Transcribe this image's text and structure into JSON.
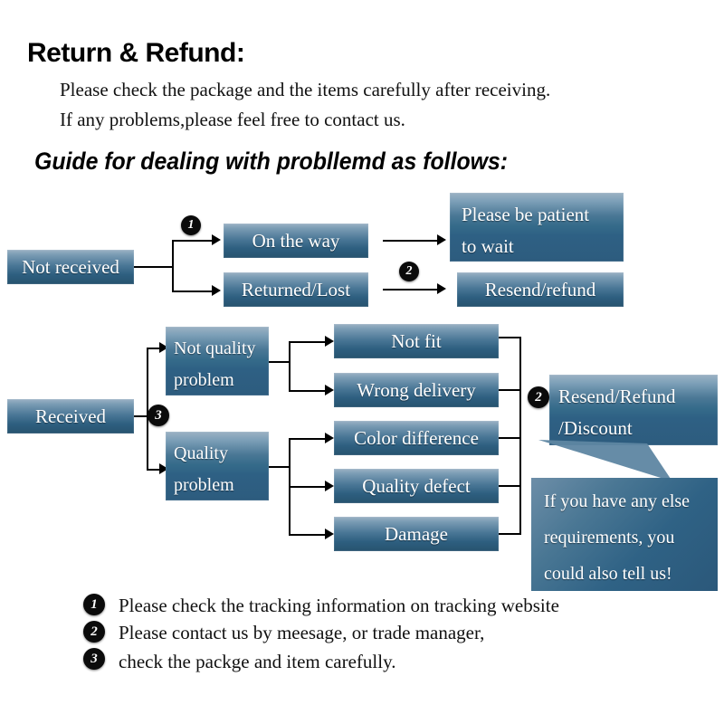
{
  "header": {
    "title": "Return & Refund:",
    "lead_line1": "Please check the package and the items carefully after receiving.",
    "lead_line2": "If any problems,please feel free to contact us.",
    "guide": "Guide for dealing with probllemd as follows:"
  },
  "colors": {
    "box_top": "#9cb2c4",
    "box_bottom": "#27536f",
    "badge_bg": "#0b0b0b",
    "badge_text": "#ffffff",
    "text": "#111111",
    "box_text": "#ffffff",
    "page_bg": "#ffffff"
  },
  "flow_not_received": {
    "source": "Not received",
    "branch_badge": "1",
    "branch1": "On the way",
    "branch2": "Returned/Lost",
    "result1_line1": "Please be patient",
    "result1_line2": "to wait",
    "result2": "Resend/refund",
    "result2_badge": "2"
  },
  "flow_received": {
    "source": "Received",
    "branch_badge": "3",
    "category1_line1": "Not quality",
    "category1_line2": "problem",
    "category2_line1": "Quality",
    "category2_line2": "problem",
    "issues": [
      "Not fit",
      "Wrong delivery",
      "Color difference",
      "Quality defect",
      "Damage"
    ],
    "outcome_badge": "2",
    "outcome_line1": "Resend/Refund",
    "outcome_line2": "/Discount",
    "bubble_line1": "If you have any else",
    "bubble_line2": "requirements, you",
    "bubble_line3": "could also tell us!"
  },
  "footnotes": [
    {
      "badge": "1",
      "text": "Please check the tracking information on tracking website"
    },
    {
      "badge": "2",
      "text": "Please contact us by meesage, or trade manager,"
    },
    {
      "badge": "3",
      "text": "check the packge and item carefully."
    }
  ]
}
